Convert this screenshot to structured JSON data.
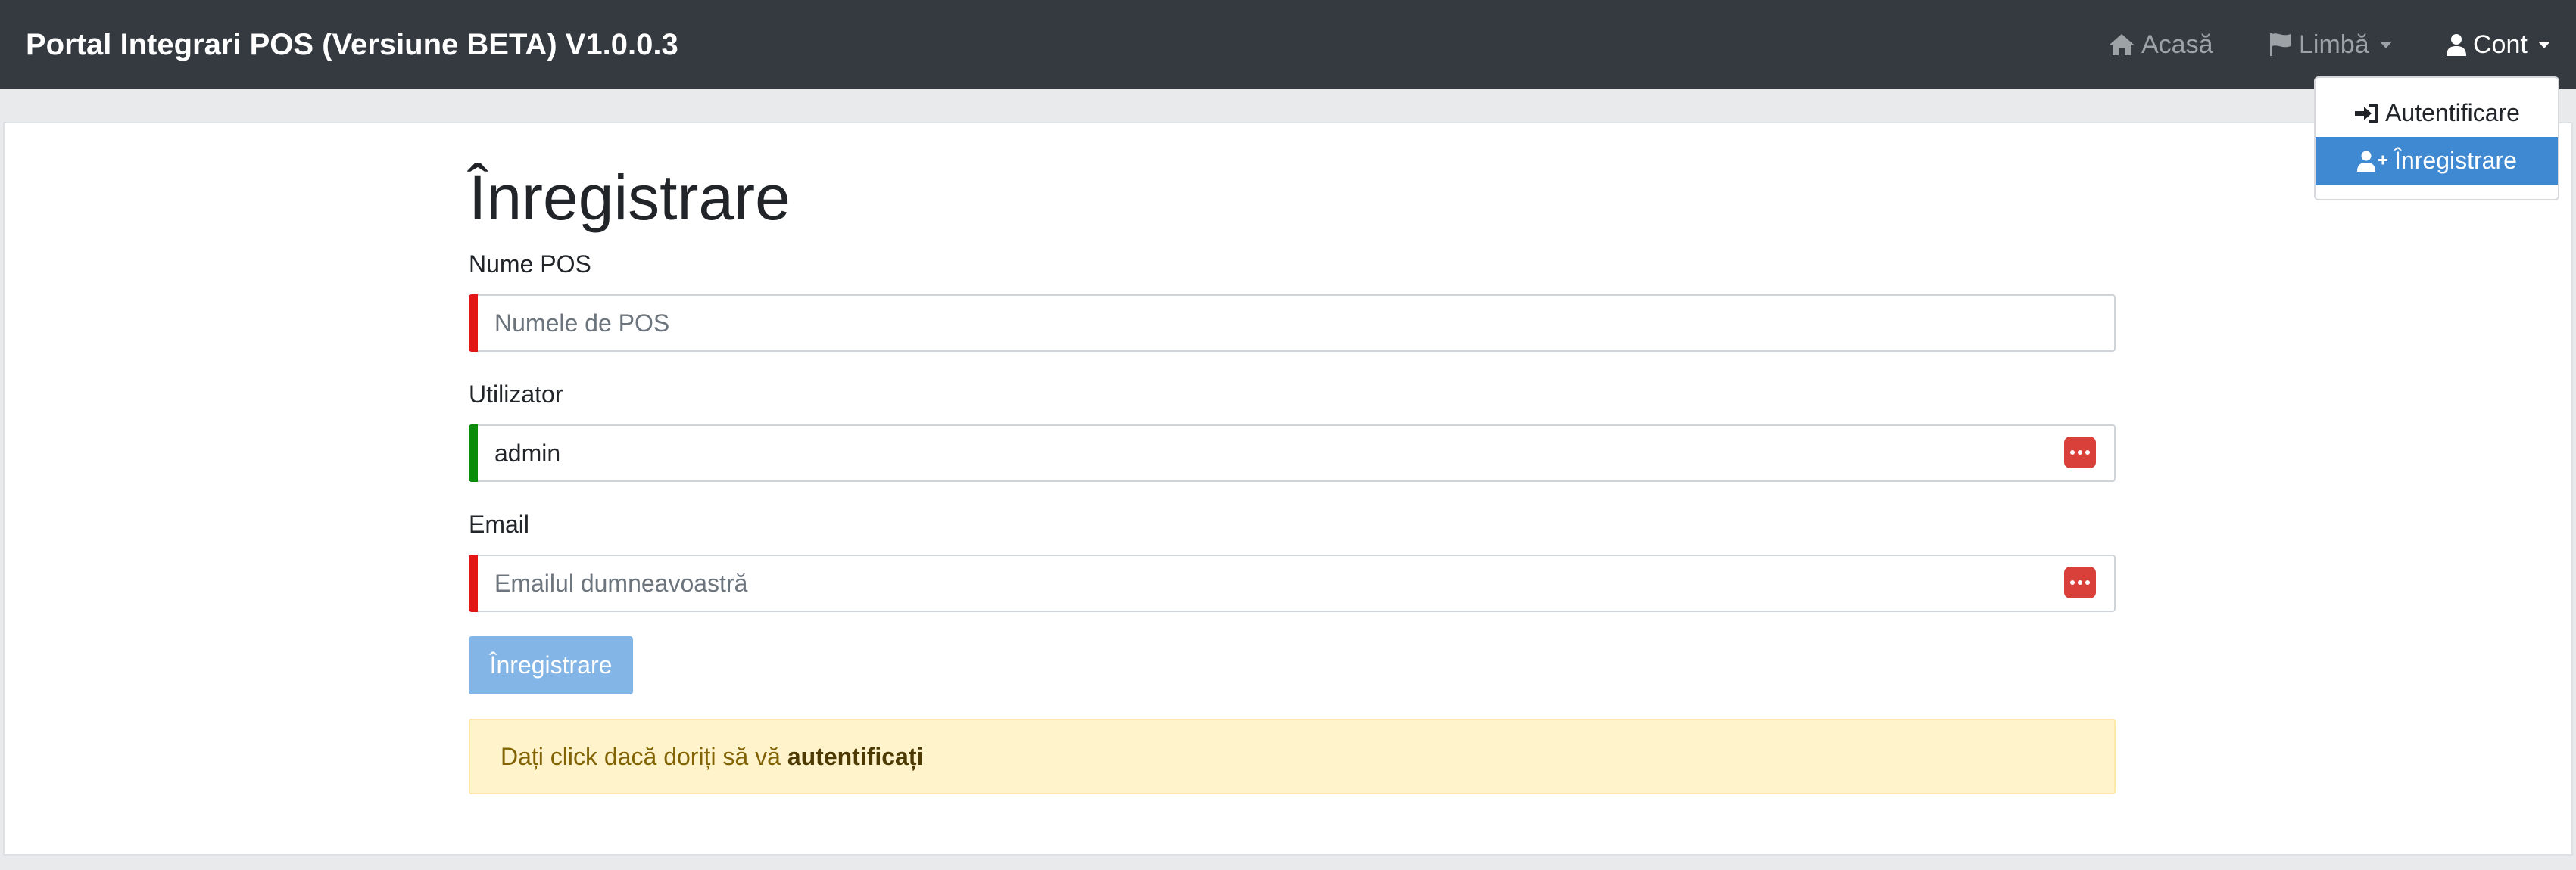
{
  "navbar": {
    "brand": "Portal Integrari POS (Versiune BETA) V1.0.0.3",
    "home": "Acasă",
    "language": "Limbă",
    "account": "Cont"
  },
  "dropdown": {
    "items": [
      {
        "label": "Autentificare",
        "icon": "sign-in-icon",
        "active": false
      },
      {
        "label": "Înregistrare",
        "icon": "user-plus-icon",
        "active": true
      }
    ]
  },
  "form": {
    "title": "Înregistrare",
    "fields": [
      {
        "label": "Nume POS",
        "value": "",
        "placeholder": "Numele de POS",
        "status": "invalid"
      },
      {
        "label": "Utilizator",
        "value": "admin",
        "placeholder": "",
        "status": "valid"
      },
      {
        "label": "Email",
        "value": "",
        "placeholder": "Emailul dumneavoastră",
        "status": "invalid"
      }
    ],
    "submit_label": "Înregistrare"
  },
  "alert": {
    "text": "Dați click dacă doriți să vă ",
    "link": "autentificați"
  },
  "colors": {
    "navbar": "#343a40",
    "active": "#3f88d2",
    "invalid": "#e31616",
    "valid": "#098d09",
    "button": "#83b6e6",
    "alert_bg": "#fff3cc"
  }
}
